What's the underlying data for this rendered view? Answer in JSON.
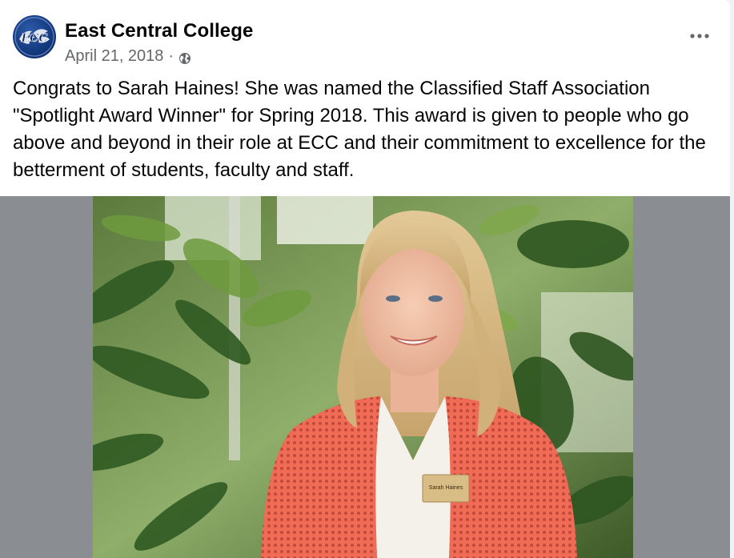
{
  "post": {
    "page_name": "East Central College",
    "avatar_text": "ECC",
    "date": "April 21, 2018",
    "separator": "·",
    "privacy_icon": "globe-icon",
    "more_icon": "more-options-icon",
    "text": "Congrats to Sarah Haines! She was named the Classified Staff Association \"Spotlight Award Winner\" for Spring 2018. This award is given to people who go above and beyond in their role at ECC and their commitment to excellence for the betterment of students, faculty and staff."
  },
  "photo": {
    "name_tag_name": "Sarah Haines"
  },
  "colors": {
    "text_primary": "#050505",
    "text_secondary": "#65676b",
    "media_background": "#8a8d91",
    "avatar_blue": "#143a80",
    "cardigan_coral": "#f0705a"
  }
}
